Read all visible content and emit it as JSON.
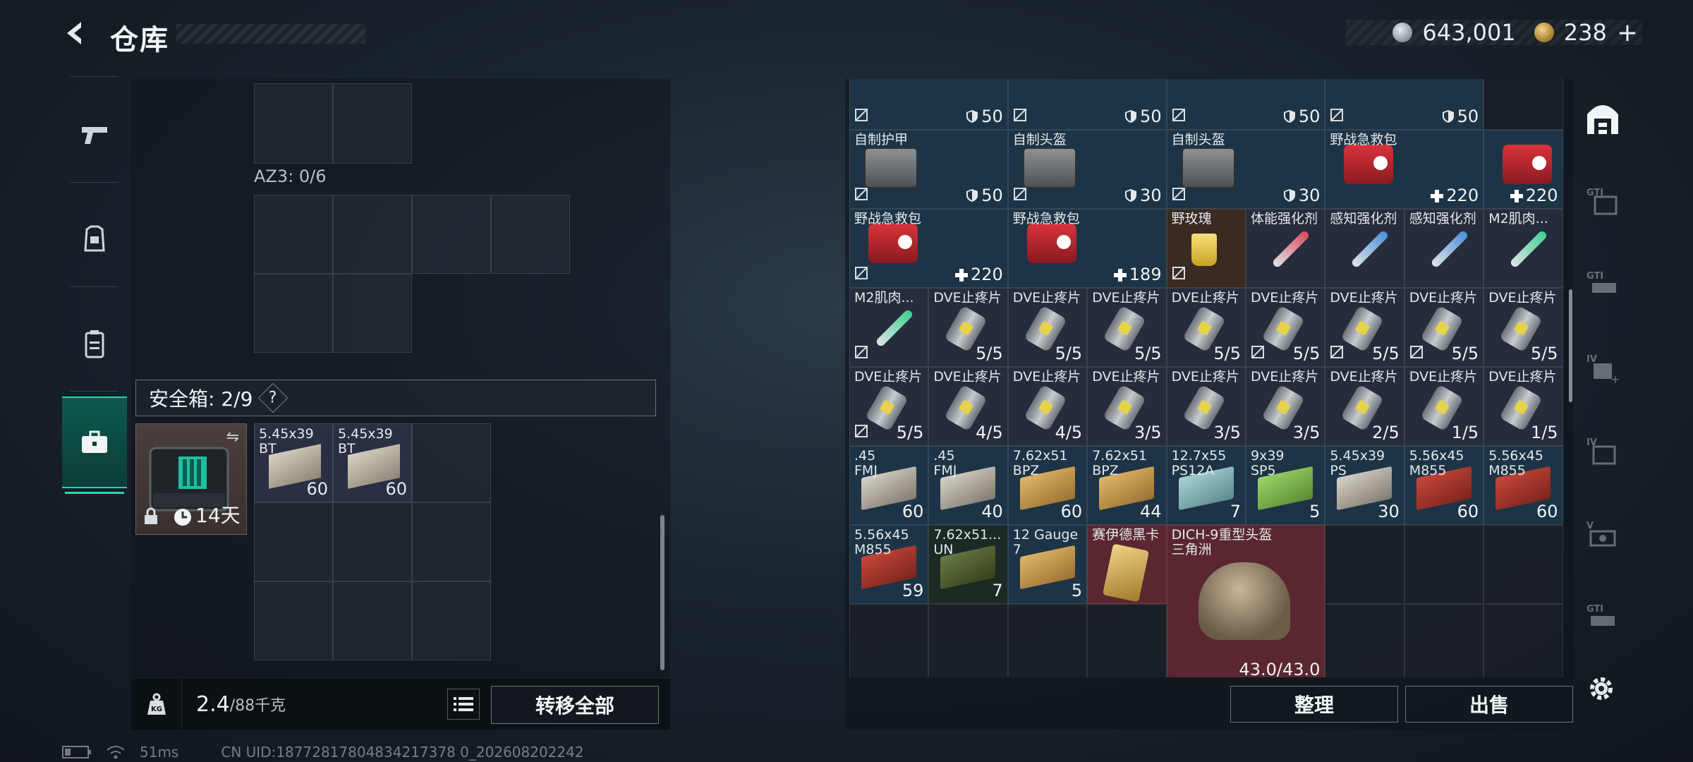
{
  "header": {
    "title": "仓库",
    "currency_silver": "643,001",
    "currency_gold": "238",
    "currency_plus": "+"
  },
  "left_panel": {
    "az_label": "AZ3: 0/6",
    "safe_box": {
      "title": "安全箱: 2/9",
      "help": "?",
      "timer": "14天"
    },
    "safe_items": [
      {
        "name": "5.45x39\nBT",
        "qty": "60"
      },
      {
        "name": "5.45x39\nBT",
        "qty": "60"
      }
    ],
    "weight_value": "2.4",
    "weight_capacity": "/88千克",
    "transfer_all": "转移全部"
  },
  "status": {
    "ping": "51ms",
    "uid": "CN UID:18772817804834217378 0_202608202242"
  },
  "inventory": {
    "row0": [
      {
        "qty": "50"
      },
      {
        "qty": "50"
      },
      {
        "qty": "50"
      },
      {
        "qty": "50"
      }
    ],
    "row1": [
      {
        "name": "自制护甲",
        "qty": "50",
        "kind": "armor"
      },
      {
        "name": "自制头盔",
        "qty": "30",
        "kind": "armor"
      },
      {
        "name": "自制头盔",
        "qty": "30",
        "kind": "armor"
      },
      {
        "name": "野战急救包",
        "qty": "220",
        "kind": "medkit"
      },
      {
        "name": "",
        "qty": "220",
        "kind": "medkit"
      }
    ],
    "row2": [
      {
        "name": "野战急救包",
        "qty": "220",
        "kind": "medkit"
      },
      {
        "name": "野战急救包",
        "qty": "189",
        "kind": "medkit"
      },
      {
        "name": "野玫瑰",
        "qty": "",
        "kind": "drink"
      },
      {
        "name": "体能强化剂",
        "qty": "",
        "kind": "syringe-red"
      },
      {
        "name": "感知强化剂",
        "qty": "",
        "kind": "syringe-blue"
      },
      {
        "name": "感知强化剂",
        "qty": "",
        "kind": "syringe-blue"
      },
      {
        "name": "M2肌肉...",
        "qty": "",
        "kind": "syringe-green"
      }
    ],
    "row3": [
      {
        "name": "M2肌肉...",
        "qty": "",
        "kind": "syringe-green"
      },
      {
        "name": "DVE止疼片",
        "qty": "5/5",
        "kind": "pill"
      },
      {
        "name": "DVE止疼片",
        "qty": "5/5",
        "kind": "pill"
      },
      {
        "name": "DVE止疼片",
        "qty": "5/5",
        "kind": "pill"
      },
      {
        "name": "DVE止疼片",
        "qty": "5/5",
        "kind": "pill"
      },
      {
        "name": "DVE止疼片",
        "qty": "5/5",
        "kind": "pill"
      },
      {
        "name": "DVE止疼片",
        "qty": "5/5",
        "kind": "pill"
      },
      {
        "name": "DVE止疼片",
        "qty": "5/5",
        "kind": "pill"
      },
      {
        "name": "DVE止疼片",
        "qty": "5/5",
        "kind": "pill"
      }
    ],
    "row4": [
      {
        "name": "DVE止疼片",
        "qty": "5/5",
        "kind": "pill"
      },
      {
        "name": "DVE止疼片",
        "qty": "4/5",
        "kind": "pill"
      },
      {
        "name": "DVE止疼片",
        "qty": "4/5",
        "kind": "pill"
      },
      {
        "name": "DVE止疼片",
        "qty": "3/5",
        "kind": "pill"
      },
      {
        "name": "DVE止疼片",
        "qty": "3/5",
        "kind": "pill"
      },
      {
        "name": "DVE止疼片",
        "qty": "3/5",
        "kind": "pill"
      },
      {
        "name": "DVE止疼片",
        "qty": "2/5",
        "kind": "pill"
      },
      {
        "name": "DVE止疼片",
        "qty": "1/5",
        "kind": "pill"
      },
      {
        "name": "DVE止疼片",
        "qty": "1/5",
        "kind": "pill"
      }
    ],
    "row5": [
      {
        "name": ".45\nFMJ",
        "qty": "60",
        "kind": "ammo-grey"
      },
      {
        "name": ".45\nFMJ",
        "qty": "40",
        "kind": "ammo-grey"
      },
      {
        "name": "7.62x51\nBPZ",
        "qty": "60",
        "kind": "ammo-tan"
      },
      {
        "name": "7.62x51\nBPZ",
        "qty": "44",
        "kind": "ammo-tan"
      },
      {
        "name": "12.7x55\nPS12A",
        "qty": "7",
        "kind": "ammo-cyan"
      },
      {
        "name": "9x39\nSP5",
        "qty": "5",
        "kind": "ammo-green"
      },
      {
        "name": "5.45x39\nPS",
        "qty": "30",
        "kind": "ammo-grey"
      },
      {
        "name": "5.56x45\nM855",
        "qty": "60",
        "kind": "ammo-red"
      },
      {
        "name": "5.56x45\nM855",
        "qty": "60",
        "kind": "ammo-red"
      }
    ],
    "row6": [
      {
        "name": "5.56x45\nM855",
        "qty": "59",
        "kind": "ammo-red"
      },
      {
        "name": "7.62x51...\nUN",
        "qty": "7",
        "kind": "ammo-olive"
      },
      {
        "name": "12 Gauge\n7",
        "qty": "5",
        "kind": "ammo-tan"
      },
      {
        "name": "赛伊德黑卡",
        "qty": "",
        "kind": "card"
      }
    ],
    "helmet": {
      "name": "DICH-9重型头盔\n三角洲",
      "durability": "43.0/43.0"
    },
    "sort_label": "整理",
    "sell_label": "出售"
  },
  "colors": {
    "accent": "#1fd9b0",
    "slot_blue": "#1e3446",
    "slot_red": "#5a2730",
    "slot_dark": "#2a3038"
  }
}
